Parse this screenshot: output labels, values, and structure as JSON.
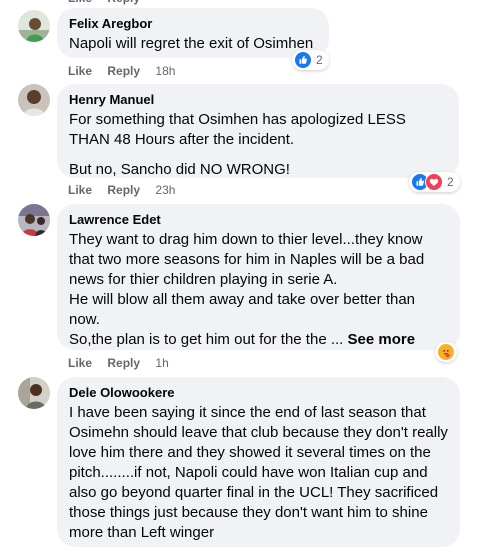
{
  "labels": {
    "like": "Like",
    "reply": "Reply"
  },
  "comments": [
    {
      "author": "Felix Aregbor",
      "paragraphs": [
        "Napoli will regret the exit of Osimhen"
      ],
      "time": "18h",
      "reaction_count": "2",
      "reaction_icons": [
        "like-icon"
      ]
    },
    {
      "author": "Henry Manuel",
      "paragraphs": [
        "For something that Osimhen has apologized LESS THAN 48 Hours after the incident.",
        "But no, Sancho did NO WRONG!"
      ],
      "time": "23h",
      "reaction_count": "2",
      "reaction_icons": [
        "like-icon",
        "love-icon"
      ]
    },
    {
      "author": "Lawrence Edet",
      "paragraphs": [
        "They want to drag him down to thier level...they know that two more seasons for him in Naples will be a bad news for thier children playing in serie A.",
        "He will blow all them away and take over better than now.",
        "So,the plan is to get him out for the the ..."
      ],
      "see_more": "See more",
      "time": "1h",
      "reaction_icons": [
        "care-icon"
      ]
    },
    {
      "author": "Dele Olowookere",
      "paragraphs": [
        "I have been saying it since the end of last season that Osimehn should leave that club because they don't really love him there and they showed it several times on the pitch........if not, Napoli could have won Italian cup and also go beyond quarter final in the UCL! They sacrificed those things just because they don't want him to shine more than Left winger"
      ]
    }
  ],
  "colors": {
    "bubble": "#f0f2f5",
    "meta": "#65676b",
    "like_blue": "#1877f2",
    "love_red": "#f33e58",
    "care_yellow": "#f7b125"
  }
}
